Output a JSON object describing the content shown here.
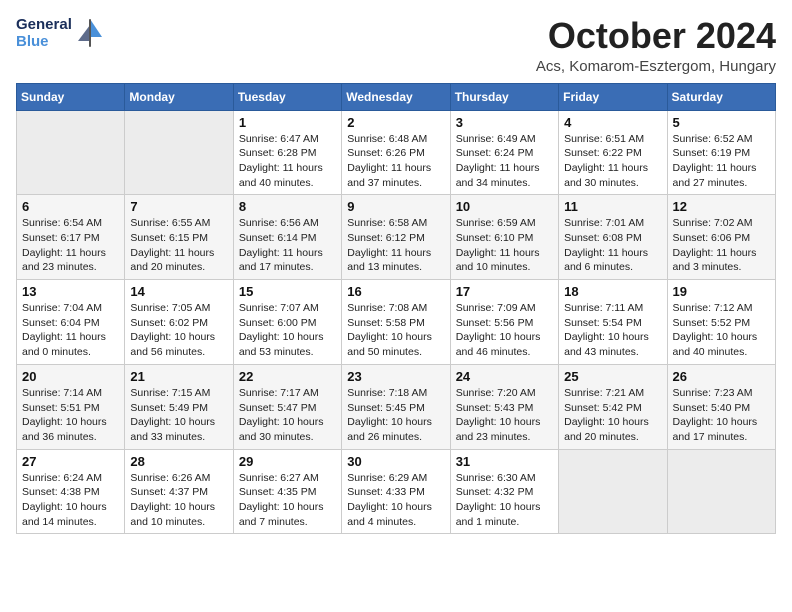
{
  "header": {
    "logo_line1": "General",
    "logo_line2": "Blue",
    "title": "October 2024",
    "subtitle": "Acs, Komarom-Esztergom, Hungary"
  },
  "weekdays": [
    "Sunday",
    "Monday",
    "Tuesday",
    "Wednesday",
    "Thursday",
    "Friday",
    "Saturday"
  ],
  "weeks": [
    [
      {
        "day": "",
        "empty": true
      },
      {
        "day": "",
        "empty": true
      },
      {
        "day": "1",
        "sunrise": "Sunrise: 6:47 AM",
        "sunset": "Sunset: 6:28 PM",
        "daylight": "Daylight: 11 hours and 40 minutes."
      },
      {
        "day": "2",
        "sunrise": "Sunrise: 6:48 AM",
        "sunset": "Sunset: 6:26 PM",
        "daylight": "Daylight: 11 hours and 37 minutes."
      },
      {
        "day": "3",
        "sunrise": "Sunrise: 6:49 AM",
        "sunset": "Sunset: 6:24 PM",
        "daylight": "Daylight: 11 hours and 34 minutes."
      },
      {
        "day": "4",
        "sunrise": "Sunrise: 6:51 AM",
        "sunset": "Sunset: 6:22 PM",
        "daylight": "Daylight: 11 hours and 30 minutes."
      },
      {
        "day": "5",
        "sunrise": "Sunrise: 6:52 AM",
        "sunset": "Sunset: 6:19 PM",
        "daylight": "Daylight: 11 hours and 27 minutes."
      }
    ],
    [
      {
        "day": "6",
        "sunrise": "Sunrise: 6:54 AM",
        "sunset": "Sunset: 6:17 PM",
        "daylight": "Daylight: 11 hours and 23 minutes."
      },
      {
        "day": "7",
        "sunrise": "Sunrise: 6:55 AM",
        "sunset": "Sunset: 6:15 PM",
        "daylight": "Daylight: 11 hours and 20 minutes."
      },
      {
        "day": "8",
        "sunrise": "Sunrise: 6:56 AM",
        "sunset": "Sunset: 6:14 PM",
        "daylight": "Daylight: 11 hours and 17 minutes."
      },
      {
        "day": "9",
        "sunrise": "Sunrise: 6:58 AM",
        "sunset": "Sunset: 6:12 PM",
        "daylight": "Daylight: 11 hours and 13 minutes."
      },
      {
        "day": "10",
        "sunrise": "Sunrise: 6:59 AM",
        "sunset": "Sunset: 6:10 PM",
        "daylight": "Daylight: 11 hours and 10 minutes."
      },
      {
        "day": "11",
        "sunrise": "Sunrise: 7:01 AM",
        "sunset": "Sunset: 6:08 PM",
        "daylight": "Daylight: 11 hours and 6 minutes."
      },
      {
        "day": "12",
        "sunrise": "Sunrise: 7:02 AM",
        "sunset": "Sunset: 6:06 PM",
        "daylight": "Daylight: 11 hours and 3 minutes."
      }
    ],
    [
      {
        "day": "13",
        "sunrise": "Sunrise: 7:04 AM",
        "sunset": "Sunset: 6:04 PM",
        "daylight": "Daylight: 11 hours and 0 minutes."
      },
      {
        "day": "14",
        "sunrise": "Sunrise: 7:05 AM",
        "sunset": "Sunset: 6:02 PM",
        "daylight": "Daylight: 10 hours and 56 minutes."
      },
      {
        "day": "15",
        "sunrise": "Sunrise: 7:07 AM",
        "sunset": "Sunset: 6:00 PM",
        "daylight": "Daylight: 10 hours and 53 minutes."
      },
      {
        "day": "16",
        "sunrise": "Sunrise: 7:08 AM",
        "sunset": "Sunset: 5:58 PM",
        "daylight": "Daylight: 10 hours and 50 minutes."
      },
      {
        "day": "17",
        "sunrise": "Sunrise: 7:09 AM",
        "sunset": "Sunset: 5:56 PM",
        "daylight": "Daylight: 10 hours and 46 minutes."
      },
      {
        "day": "18",
        "sunrise": "Sunrise: 7:11 AM",
        "sunset": "Sunset: 5:54 PM",
        "daylight": "Daylight: 10 hours and 43 minutes."
      },
      {
        "day": "19",
        "sunrise": "Sunrise: 7:12 AM",
        "sunset": "Sunset: 5:52 PM",
        "daylight": "Daylight: 10 hours and 40 minutes."
      }
    ],
    [
      {
        "day": "20",
        "sunrise": "Sunrise: 7:14 AM",
        "sunset": "Sunset: 5:51 PM",
        "daylight": "Daylight: 10 hours and 36 minutes."
      },
      {
        "day": "21",
        "sunrise": "Sunrise: 7:15 AM",
        "sunset": "Sunset: 5:49 PM",
        "daylight": "Daylight: 10 hours and 33 minutes."
      },
      {
        "day": "22",
        "sunrise": "Sunrise: 7:17 AM",
        "sunset": "Sunset: 5:47 PM",
        "daylight": "Daylight: 10 hours and 30 minutes."
      },
      {
        "day": "23",
        "sunrise": "Sunrise: 7:18 AM",
        "sunset": "Sunset: 5:45 PM",
        "daylight": "Daylight: 10 hours and 26 minutes."
      },
      {
        "day": "24",
        "sunrise": "Sunrise: 7:20 AM",
        "sunset": "Sunset: 5:43 PM",
        "daylight": "Daylight: 10 hours and 23 minutes."
      },
      {
        "day": "25",
        "sunrise": "Sunrise: 7:21 AM",
        "sunset": "Sunset: 5:42 PM",
        "daylight": "Daylight: 10 hours and 20 minutes."
      },
      {
        "day": "26",
        "sunrise": "Sunrise: 7:23 AM",
        "sunset": "Sunset: 5:40 PM",
        "daylight": "Daylight: 10 hours and 17 minutes."
      }
    ],
    [
      {
        "day": "27",
        "sunrise": "Sunrise: 6:24 AM",
        "sunset": "Sunset: 4:38 PM",
        "daylight": "Daylight: 10 hours and 14 minutes."
      },
      {
        "day": "28",
        "sunrise": "Sunrise: 6:26 AM",
        "sunset": "Sunset: 4:37 PM",
        "daylight": "Daylight: 10 hours and 10 minutes."
      },
      {
        "day": "29",
        "sunrise": "Sunrise: 6:27 AM",
        "sunset": "Sunset: 4:35 PM",
        "daylight": "Daylight: 10 hours and 7 minutes."
      },
      {
        "day": "30",
        "sunrise": "Sunrise: 6:29 AM",
        "sunset": "Sunset: 4:33 PM",
        "daylight": "Daylight: 10 hours and 4 minutes."
      },
      {
        "day": "31",
        "sunrise": "Sunrise: 6:30 AM",
        "sunset": "Sunset: 4:32 PM",
        "daylight": "Daylight: 10 hours and 1 minute."
      },
      {
        "day": "",
        "empty": true
      },
      {
        "day": "",
        "empty": true
      }
    ]
  ]
}
